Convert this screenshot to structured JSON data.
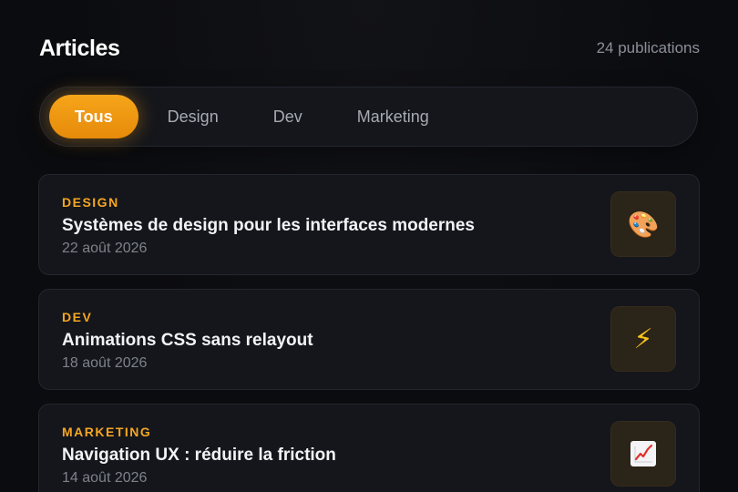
{
  "header": {
    "title": "Articles",
    "count_label": "24 publications"
  },
  "filters": {
    "tabs": [
      {
        "label": "Tous",
        "active": true
      },
      {
        "label": "Design",
        "active": false
      },
      {
        "label": "Dev",
        "active": false
      },
      {
        "label": "Marketing",
        "active": false
      }
    ]
  },
  "articles": [
    {
      "category": "DESIGN",
      "title": "Systèmes de design pour les interfaces modernes",
      "date": "22 août 2026",
      "icon": "palette-icon",
      "glyph": "🎨"
    },
    {
      "category": "DEV",
      "title": "Animations CSS sans relayout",
      "date": "18 août 2026",
      "icon": "lightning-icon",
      "glyph": "⚡"
    },
    {
      "category": "MARKETING",
      "title": "Navigation UX : réduire la friction",
      "date": "14 août 2026",
      "icon": "chart-up-icon",
      "glyph": ""
    }
  ],
  "colors": {
    "accent": "#f5a623",
    "background": "#0b0c10",
    "card": "#14161b"
  }
}
